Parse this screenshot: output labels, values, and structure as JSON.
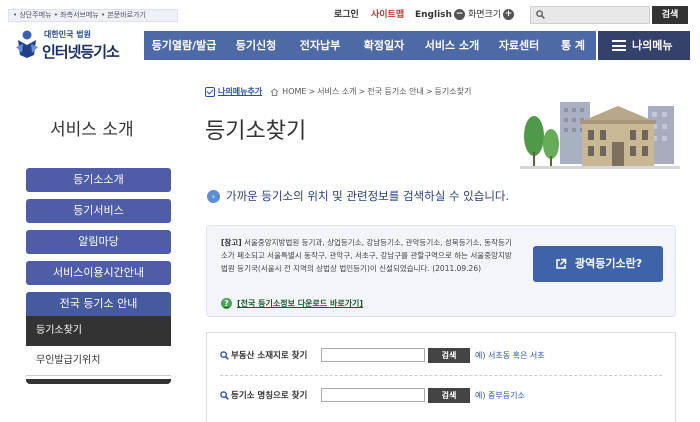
{
  "top_links": {
    "skip": "• 상단주메뉴 • 좌측서브메뉴 • 본문바로가기"
  },
  "util": {
    "login": "로그인",
    "sitemap": "사이트맵",
    "english": "English",
    "screen_size": "화면크기"
  },
  "top_search": {
    "placeholder": "",
    "button": "검색"
  },
  "logo": {
    "sub": "대한민국 법원",
    "main": "인터넷등기소"
  },
  "nav": {
    "items": [
      "등기열람/발급",
      "등기신청",
      "전자납부",
      "확정일자",
      "서비스 소개",
      "자료센터",
      "통 계"
    ],
    "my_menu": "나의메뉴"
  },
  "breadcrumb": {
    "add_my_menu": "나의메뉴추가",
    "home": "HOME",
    "path1": "서비스 소개",
    "path2": "전국 등기소 안내",
    "path3": "등기소찾기"
  },
  "sidebar": {
    "title": "서비스 소개",
    "items": [
      "등기소소개",
      "등기서비스",
      "알림마당",
      "서비스이용시간안내",
      "전국 등기소 안내"
    ],
    "sub_items": [
      "등기소찾기",
      "무인발급기위치"
    ]
  },
  "page_title": "등기소찾기",
  "intro": "가까운 등기소의 위치 및 관련정보를 검색하실 수 있습니다.",
  "notice": {
    "label": "[참고]",
    "text": "서울중앙지방법원 등기과, 상업등기소, 강남등기소, 관악등기소, 성북등기소, 동작등기소가 폐소되고 서울특별시 동작구, 관악구, 서초구, 강남구를 관할구역으로 하는 서울중앙지방법원 등기국(서울시 전 지역의 상법상 법인등기)이 신설되었습니다. (2011.09.26)",
    "download_link": "[전국 등기소정보 다운로드 바로가기]",
    "wide_button": "광역등기소란?"
  },
  "search": {
    "row1": {
      "label": "부동산 소재지로 찾기",
      "value": "",
      "button": "검색",
      "example": "예) 서초동 혹은 서초"
    },
    "row2": {
      "label": "등기소 명칭으로 찾기",
      "value": "",
      "button": "검색",
      "example": "예) 중부등기소"
    }
  },
  "colors": {
    "nav": "#4d69a6",
    "my_menu": "#34426b",
    "side_button": "#4f5ca7",
    "accent_blue": "#3f63a8"
  }
}
